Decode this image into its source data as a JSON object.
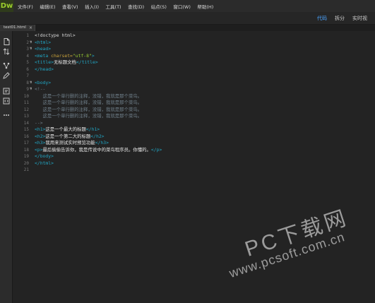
{
  "app": {
    "logo": "Dw"
  },
  "menu": [
    "文件(F)",
    "编辑(E)",
    "查看(V)",
    "插入(I)",
    "工具(T)",
    "查找(D)",
    "站点(S)",
    "窗口(W)",
    "帮助(H)"
  ],
  "view_tabs": [
    {
      "label": "代码",
      "active": true
    },
    {
      "label": "拆分",
      "active": false
    },
    {
      "label": "实时视",
      "active": false
    }
  ],
  "document_tab": {
    "label": "test01.html",
    "close": "×"
  },
  "toolbar_icons": [
    "file-icon",
    "sort-icon",
    "code-nav-icon",
    "pen-icon",
    "outline-icon",
    "code-icon",
    "more-icon"
  ],
  "code_lines": [
    {
      "n": "1",
      "fold": "",
      "html": "<span class=\"doc\">&lt;!doctype html&gt;</span>"
    },
    {
      "n": "2",
      "fold": "▼",
      "html": "<span class=\"tag\">&lt;html&gt;</span>"
    },
    {
      "n": "3",
      "fold": "▼",
      "html": "<span class=\"tag\">&lt;head&gt;</span>"
    },
    {
      "n": "4",
      "fold": "",
      "html": "<span class=\"tag\">&lt;meta</span> <span class=\"attr\">charset=</span><span class=\"str\">\"utf-8\"</span><span class=\"tag\">&gt;</span>"
    },
    {
      "n": "5",
      "fold": "",
      "html": "<span class=\"tag\">&lt;title&gt;</span><span class=\"txt\">无标题文档</span><span class=\"tag\">&lt;/title&gt;</span>"
    },
    {
      "n": "6",
      "fold": "",
      "html": "<span class=\"tag\">&lt;/head&gt;</span>"
    },
    {
      "n": "7",
      "fold": "",
      "html": ""
    },
    {
      "n": "8",
      "fold": "▼",
      "html": "<span class=\"tag\">&lt;body&gt;</span>"
    },
    {
      "n": "9",
      "fold": "▼",
      "html": "<span class=\"cmt\">&lt;!--</span>"
    },
    {
      "n": "10",
      "fold": "",
      "html": "<span class=\"cmt\">   这是一个单行删的注释，没错，我就是那个菜鸟。</span>"
    },
    {
      "n": "11",
      "fold": "",
      "html": "<span class=\"cmt\">   这是一个单行删的注释，没错，我就是那个菜鸟。</span>"
    },
    {
      "n": "12",
      "fold": "",
      "html": "<span class=\"cmt\">   这是一个单行删的注释，没错，我就是那个菜鸟。</span>"
    },
    {
      "n": "13",
      "fold": "",
      "html": "<span class=\"cmt\">   这是一个单行删的注释，没错，我就是那个菜鸟。</span>"
    },
    {
      "n": "14",
      "fold": "",
      "html": "<span class=\"cmt\">--&gt;</span>"
    },
    {
      "n": "15",
      "fold": "",
      "html": "<span class=\"tag\">&lt;h1&gt;</span><span class=\"txt\">这是一个最大的标题</span><span class=\"tag\">&lt;/h1&gt;</span>"
    },
    {
      "n": "16",
      "fold": "",
      "html": "<span class=\"tag\">&lt;h2&gt;</span><span class=\"txt\">这是一个第二大的标题</span><span class=\"tag\">&lt;/h2&gt;</span>"
    },
    {
      "n": "17",
      "fold": "",
      "html": "<span class=\"tag\">&lt;h3&gt;</span><span class=\"txt\">我用来测试实时预览功能</span><span class=\"tag\">&lt;/h3&gt;</span>"
    },
    {
      "n": "18",
      "fold": "",
      "html": "<span class=\"tag\">&lt;p&gt;</span><span class=\"txt\">最后偷偷告诉你，我是传说中的菜鸟程序员。你懂的。</span><span class=\"tag\">&lt;/p&gt;</span>"
    },
    {
      "n": "19",
      "fold": "",
      "html": "<span class=\"tag\">&lt;/body&gt;</span>"
    },
    {
      "n": "20",
      "fold": "",
      "html": "<span class=\"tag\">&lt;/html&gt;</span>"
    },
    {
      "n": "21",
      "fold": "",
      "html": ""
    }
  ],
  "watermark": {
    "big": "PC下载网",
    "small": "www.pcsoft.com.cn"
  }
}
